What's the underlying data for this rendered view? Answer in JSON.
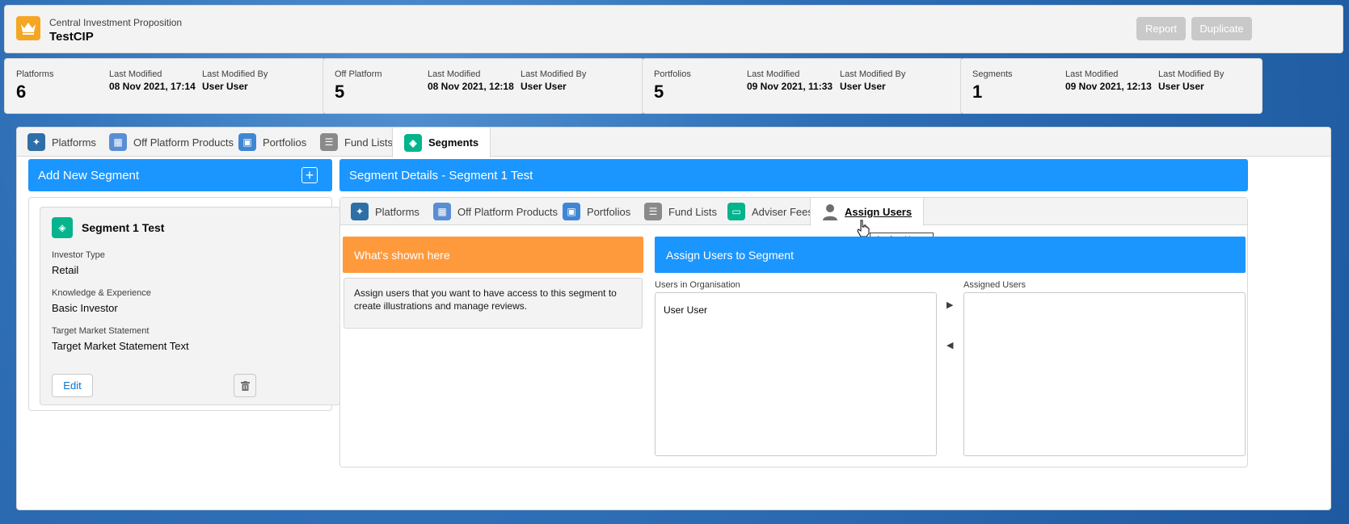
{
  "header": {
    "subtitle": "Central Investment Proposition",
    "title": "TestCIP",
    "report_label": "Report",
    "duplicate_label": "Duplicate"
  },
  "stats": [
    {
      "label": "Platforms",
      "value": "6",
      "modified_label": "Last Modified",
      "modified": "08 Nov 2021, 17:14",
      "by_label": "Last Modified By",
      "by": "User User"
    },
    {
      "label": "Off Platform",
      "value": "5",
      "modified_label": "Last Modified",
      "modified": "08 Nov 2021, 12:18",
      "by_label": "Last Modified By",
      "by": "User User"
    },
    {
      "label": "Portfolios",
      "value": "5",
      "modified_label": "Last Modified",
      "modified": "09 Nov 2021, 11:33",
      "by_label": "Last Modified By",
      "by": "User User"
    },
    {
      "label": "Segments",
      "value": "1",
      "modified_label": "Last Modified",
      "modified": "09 Nov 2021, 12:13",
      "by_label": "Last Modified By",
      "by": "User User"
    }
  ],
  "tabs": [
    {
      "label": "Platforms",
      "icon": "platform-icon"
    },
    {
      "label": "Off Platform Products",
      "icon": "table-icon"
    },
    {
      "label": "Portfolios",
      "icon": "portfolio-icon"
    },
    {
      "label": "Fund Lists",
      "icon": "list-icon"
    },
    {
      "label": "Segments",
      "icon": "segment-icon"
    }
  ],
  "add_segment": {
    "label": "Add New Segment"
  },
  "segment": {
    "name": "Segment 1 Test",
    "investor_type_label": "Investor Type",
    "investor_type": "Retail",
    "knowledge_label": "Knowledge & Experience",
    "knowledge": "Basic Investor",
    "target_label": "Target Market Statement",
    "target": "Target Market Statement Text",
    "edit_label": "Edit"
  },
  "details": {
    "title": "Segment Details - Segment 1 Test",
    "subtabs": [
      {
        "label": "Platforms"
      },
      {
        "label": "Off Platform Products"
      },
      {
        "label": "Portfolios"
      },
      {
        "label": "Fund Lists"
      },
      {
        "label": "Adviser Fees"
      },
      {
        "label": "Assign Users"
      }
    ],
    "tooltip": "Assign Users",
    "whats_shown_title": "What's shown here",
    "whats_shown_text": "Assign users that you want to have access to this segment to create illustrations and manage reviews.",
    "assign_title": "Assign Users to Segment",
    "users_in_org_label": "Users in Organisation",
    "assigned_users_label": "Assigned Users",
    "org_users": [
      "User User"
    ],
    "assigned_users": []
  },
  "colors": {
    "brand_blue": "#1b96ff",
    "orange": "#ff9a3c",
    "segment_green": "#04b48c"
  }
}
